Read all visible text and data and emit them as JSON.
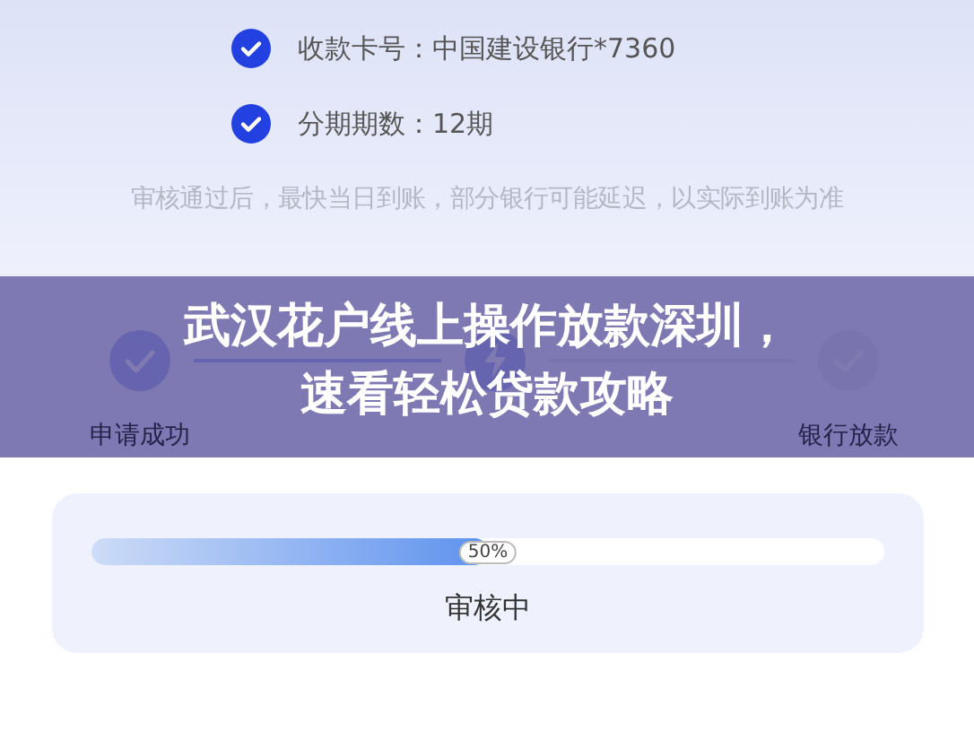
{
  "details": [
    {
      "label": "收款卡号：",
      "value": "中国建设银行*7360",
      "checked": true
    },
    {
      "label": "分期期数：",
      "value": "12期",
      "checked": true
    }
  ],
  "note": "审核通过后，最快当日到账，部分银行可能延迟，以实际到账为准",
  "steps": [
    {
      "label": "申请成功",
      "kind": "done"
    },
    {
      "kind": "current"
    },
    {
      "label": "银行放款",
      "kind": "pending"
    }
  ],
  "banner": {
    "title_lines": [
      "武汉花户线上操作放款深圳，",
      "速看轻松贷款攻略"
    ]
  },
  "progress": {
    "level": 0.5,
    "reading": "50%",
    "status": "审核中"
  }
}
